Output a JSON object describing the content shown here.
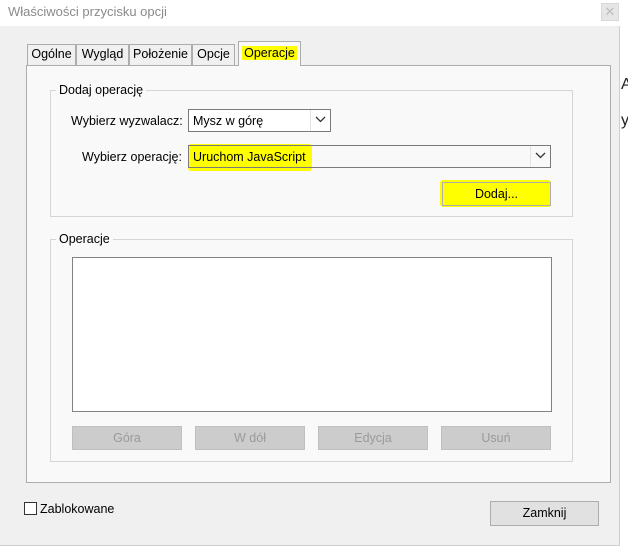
{
  "window": {
    "title": "Właściwości przycisku opcji",
    "close_glyph": "✕"
  },
  "tabs": [
    {
      "label": "Ogólne",
      "active": false
    },
    {
      "label": "Wygląd",
      "active": false
    },
    {
      "label": "Położenie",
      "active": false
    },
    {
      "label": "Opcje",
      "active": false
    },
    {
      "label": "Operacje",
      "active": true
    }
  ],
  "add_action": {
    "legend": "Dodaj operację",
    "trigger_label": "Wybierz wyzwalacz:",
    "trigger_value": "Mysz w górę",
    "action_label": "Wybierz operację:",
    "action_value": "Uruchom JavaScript",
    "add_button": "Dodaj..."
  },
  "actions": {
    "legend": "Operacje",
    "items": [],
    "buttons": {
      "up": "Góra",
      "down": "W dół",
      "edit": "Edycja",
      "delete": "Usuń"
    }
  },
  "footer": {
    "locked_label": "Zablokowane",
    "locked_checked": false,
    "close_button": "Zamknij"
  },
  "edge_glyphs": [
    "A",
    "y"
  ],
  "colors": {
    "highlight": "#ffff00",
    "dialog_bg": "#f0f0f0",
    "panel_bg": "#f9f9f9"
  }
}
